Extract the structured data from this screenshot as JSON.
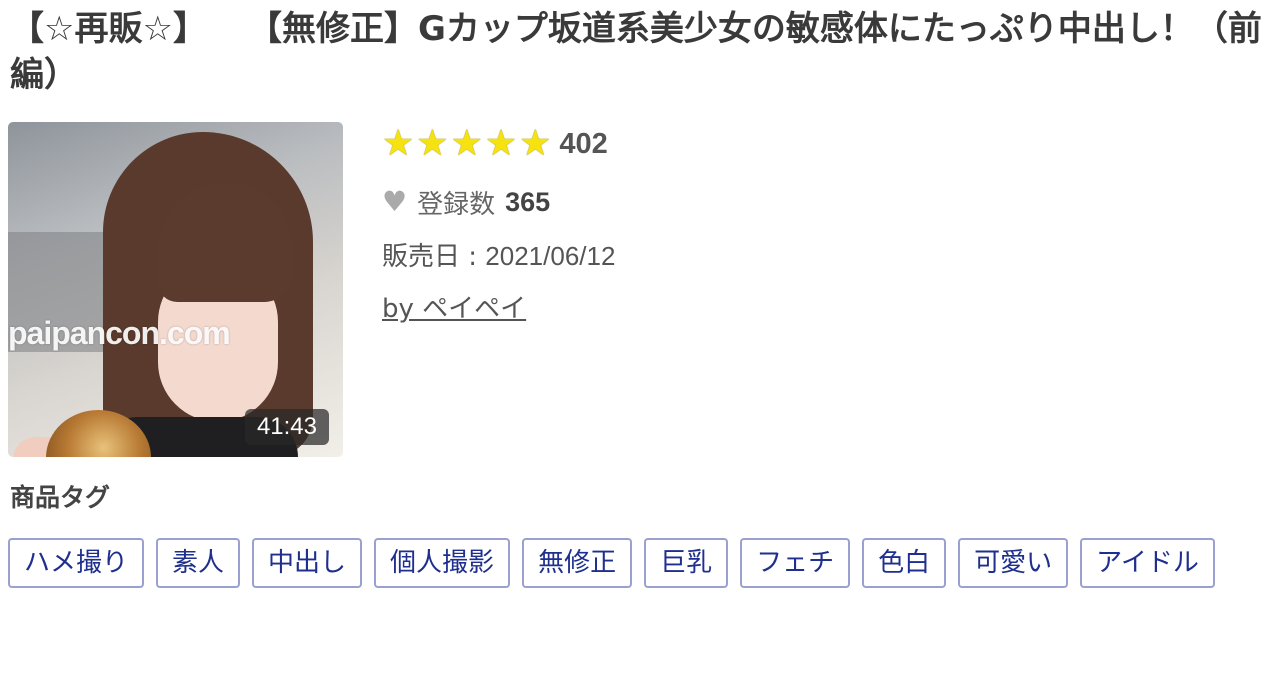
{
  "product": {
    "title_prefix": "【☆再販☆】",
    "title_main": "【無修正】Gカップ坂道系美少女の敏感体にたっぷり中出し！（前編）"
  },
  "thumbnail": {
    "watermark": "paipancon.com",
    "duration": "41:43"
  },
  "rating": {
    "stars": 5,
    "star_glyph": "★",
    "count": "402"
  },
  "favorites": {
    "icon": "heart-icon",
    "label": "登録数",
    "count": "365"
  },
  "release": {
    "label": "販売日 : ",
    "value": "2021/06/12"
  },
  "author": {
    "text": "by ペイペイ"
  },
  "tags_section": {
    "heading": "商品タグ",
    "tags": [
      "ハメ撮り",
      "素人",
      "中出し",
      "個人撮影",
      "無修正",
      "巨乳",
      "フェチ",
      "色白",
      "可愛い",
      "アイドル"
    ]
  },
  "colors": {
    "star": "#f5e210",
    "tag_border": "#9aa0cf",
    "tag_text": "#1f2f8e"
  }
}
